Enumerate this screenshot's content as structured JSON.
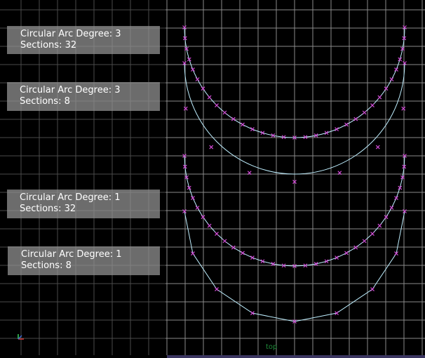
{
  "viewport": {
    "camera_label": "top",
    "colors": {
      "background": "#000000",
      "grid_major": "#8a8a8a",
      "grid_minor": "#4a4a4a",
      "curve": "#bfefff",
      "cv": "#d24bd6"
    }
  },
  "annotations": [
    {
      "line1": "Circular Arc Degree: 3",
      "line2": "Sections: 32"
    },
    {
      "line1": "Circular Arc Degree: 3",
      "line2": "Sections: 8"
    },
    {
      "line1": "Circular Arc Degree: 1",
      "line2": "Sections: 32"
    },
    {
      "line1": "Circular Arc Degree: 1",
      "line2": "Sections: 8"
    }
  ],
  "axis_icon": {
    "icon": "axis-gizmo-icon"
  }
}
